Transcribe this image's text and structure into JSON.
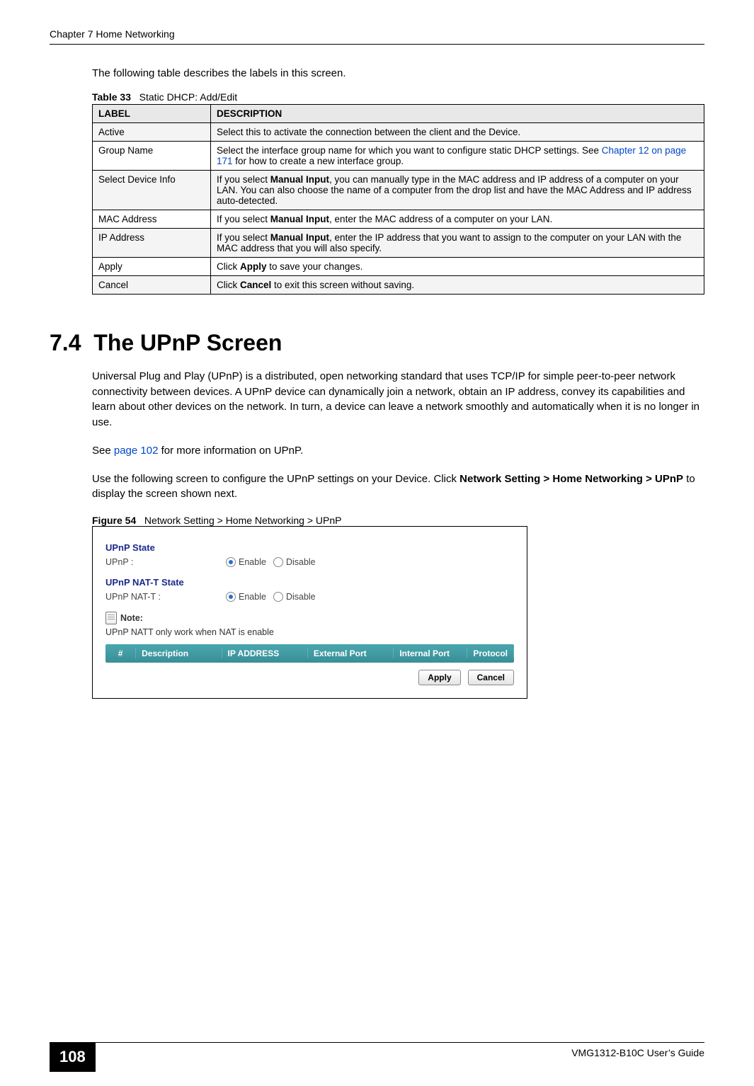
{
  "header": {
    "chapter": "Chapter 7 Home Networking"
  },
  "intro": "The following table describes the labels in this screen.",
  "table_caption": {
    "prefix": "Table 33",
    "title": "Static DHCP: Add/Edit"
  },
  "table_headers": {
    "label": "LABEL",
    "description": "DESCRIPTION"
  },
  "rows": [
    {
      "label": "Active",
      "desc": "Select this to activate the connection between the client and the Device."
    },
    {
      "label": "Group Name",
      "desc_pre": "Select the interface group name for which you want to configure static DHCP settings. See ",
      "link": "Chapter 12 on page 171",
      "desc_post": " for how to create a new interface group."
    },
    {
      "label": "Select Device Info",
      "desc_pre": "If you select ",
      "bold": "Manual Input",
      "desc_post": ", you can manually type in the MAC address and IP address of a computer on your LAN. You can also choose the name of a computer from the drop list and have the MAC Address and IP address auto-detected."
    },
    {
      "label": "MAC Address",
      "desc_pre": "If you select ",
      "bold": "Manual Input",
      "desc_post": ", enter the MAC address of a computer on your LAN."
    },
    {
      "label": "IP Address",
      "desc_pre": "If you select ",
      "bold": "Manual Input",
      "desc_post": ", enter the IP address that you want to assign to the computer on your LAN with the MAC address that you will also specify."
    },
    {
      "label": "Apply",
      "desc_pre": "Click ",
      "bold": "Apply",
      "desc_post": " to save your changes."
    },
    {
      "label": "Cancel",
      "desc_pre": "Click ",
      "bold": "Cancel",
      "desc_post": " to exit this screen without saving."
    }
  ],
  "section": {
    "number": "7.4",
    "title": "The UPnP Screen"
  },
  "para1": "Universal Plug and Play (UPnP) is a distributed, open networking standard that uses TCP/IP for simple peer-to-peer network connectivity between devices. A UPnP device can dynamically join a network, obtain an IP address, convey its capabilities and learn about other devices on the network. In turn, a device can leave a network smoothly and automatically when it is no longer in use.",
  "para2_pre": "See ",
  "para2_link": "page 102",
  "para2_post": " for more information on UPnP.",
  "para3_pre": "Use the following screen to configure the UPnP settings on your Device. Click ",
  "para3_b1": "Network Setting > Home Networking > UPnP",
  "para3_post": " to display the screen shown next.",
  "figure_caption": {
    "prefix": "Figure 54",
    "title": "Network Setting > Home Networking > UPnP"
  },
  "figure": {
    "state1": "UPnP State",
    "row1_label": "UPnP :",
    "enable": "Enable",
    "disable": "Disable",
    "state2": "UPnP NAT-T State",
    "row2_label": "UPnP NAT-T :",
    "note_label": "Note:",
    "note_text": "UPnP NATT only work when NAT is enable",
    "cols": {
      "hash": "#",
      "desc": "Description",
      "ip": "IP ADDRESS",
      "ext": "External Port",
      "intp": "Internal Port",
      "proto": "Protocol"
    },
    "apply": "Apply",
    "cancel": "Cancel"
  },
  "footer": {
    "page": "108",
    "guide": "VMG1312-B10C User’s Guide"
  }
}
